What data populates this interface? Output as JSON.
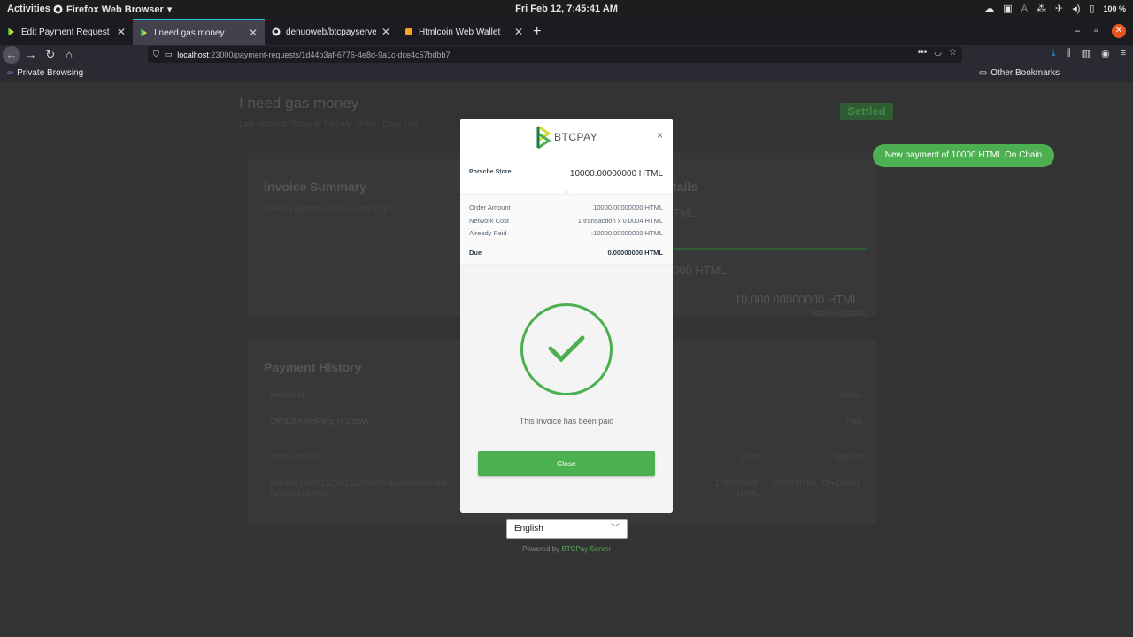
{
  "system": {
    "activities": "Activities",
    "app_name": "Firefox Web Browser",
    "clock": "Fri Feb 12,  7:45:41 AM",
    "battery": "100 %"
  },
  "tabs": [
    {
      "label": "Edit Payment Request",
      "active": false
    },
    {
      "label": "I need gas money",
      "active": true
    },
    {
      "label": "denuoweb/btcpayserver: A",
      "active": false
    },
    {
      "label": "Htmlcoin Web Wallet",
      "active": false
    }
  ],
  "nav": {
    "url_host": "localhost",
    "url_path": ":23000/payment-requests/1d44b3af-6776-4e8d-9a1c-dce4c57bdbb7"
  },
  "bookmarks": {
    "private_label": "Private Browsing",
    "other_label": "Other Bookmarks"
  },
  "background": {
    "title": "I need gas money",
    "subtitle": "Last Updated: Today at 7:45 AM   ·   Print   ·   Copy Link",
    "status": "Settled",
    "invoice_summary_heading": "Invoice Summary",
    "invoice_summary_text": "I need a porsche and I ran out of gas",
    "details_heading": "tails",
    "details_amount": "TML",
    "details_paid": "000 HTML",
    "total": "10,000.00000000 HTML",
    "total_label": "Total Requested",
    "payment_history_heading": "Payment History",
    "invoice_id_header": "Invoice Id",
    "status_header": "Status",
    "invoice_id": "QWdDFfukfqPwqgTF2dzWt",
    "invoice_status": "Paid",
    "transaction_header": "Transaction Id",
    "date_header": "Date",
    "amount_header": "Payment",
    "transaction_id": "f6eb6667ad9b1a2f0c1b226f8e5fc4dcaf5e9e5c96b3cdf2ea41f7f2b3f4e4",
    "transaction_id2": "0e9ee5e7d3f4b1...",
    "paid_amount": "1.00000000",
    "paid_unit": "HTML",
    "paid_method": "10000 HTML (On-Chain)"
  },
  "toast": {
    "text": "New payment of 10000 HTML On Chain"
  },
  "modal": {
    "logo_text": "BTCPAY",
    "close_icon": "×",
    "store_name": "Porsche Store",
    "store_amount": "10000.00000000 HTML",
    "lines": [
      {
        "label": "Order Amount",
        "value": "10000.00000000 HTML"
      },
      {
        "label": "Network Cost",
        "value": "1 transaction x 0.0004 HTML"
      },
      {
        "label": "Already Paid",
        "value": "-10000.00000000 HTML"
      }
    ],
    "due_label": "Due",
    "due_value": "0.00000000 HTML",
    "paid_message": "This invoice has been paid",
    "close_button": "Close"
  },
  "language": {
    "selected": "English"
  },
  "footer": {
    "prefix": "Powered by ",
    "link": "BTCPay Server"
  },
  "colors": {
    "accent": "#4caf50",
    "tab_highlight": "#20c1e0"
  }
}
